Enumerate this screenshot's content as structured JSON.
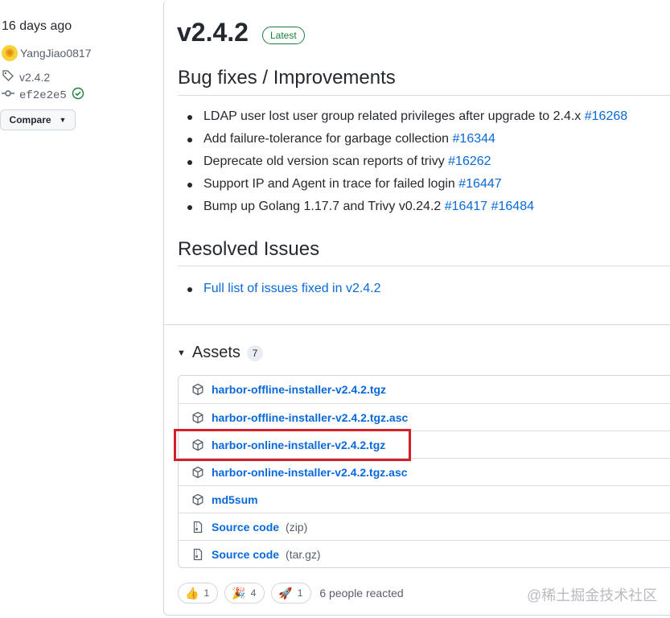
{
  "sidebar": {
    "time_ago": "16 days ago",
    "author": "YangJiao0817",
    "tag": "v2.4.2",
    "commit": "ef2e2e5",
    "compare_label": "Compare"
  },
  "release": {
    "version": "v2.4.2",
    "badge": "Latest",
    "bug_heading": "Bug fixes / Improvements",
    "bug_items": [
      {
        "text": "LDAP user lost user group related privileges after upgrade to 2.4.x ",
        "links": [
          "#16268"
        ]
      },
      {
        "text": "Add failure-tolerance for garbage collection ",
        "links": [
          "#16344"
        ]
      },
      {
        "text": "Deprecate old version scan reports of trivy ",
        "links": [
          "#16262"
        ]
      },
      {
        "text": "Support IP and Agent in trace for failed login ",
        "links": [
          "#16447"
        ]
      },
      {
        "text": "Bump up Golang 1.17.7 and Trivy v0.24.2 ",
        "links": [
          "#16417",
          "#16484"
        ]
      }
    ],
    "resolved_heading": "Resolved Issues",
    "resolved_link": "Full list of issues fixed in v2.4.2"
  },
  "assets": {
    "title": "Assets",
    "count": "7",
    "items": [
      {
        "name": "harbor-offline-installer-v2.4.2.tgz",
        "suffix": "",
        "icon": "package-icon"
      },
      {
        "name": "harbor-offline-installer-v2.4.2.tgz.asc",
        "suffix": "",
        "icon": "package-icon"
      },
      {
        "name": "harbor-online-installer-v2.4.2.tgz",
        "suffix": "",
        "icon": "package-icon"
      },
      {
        "name": "harbor-online-installer-v2.4.2.tgz.asc",
        "suffix": "",
        "icon": "package-icon"
      },
      {
        "name": "md5sum",
        "suffix": "",
        "icon": "package-icon"
      },
      {
        "name": "Source code",
        "suffix": "(zip)",
        "icon": "file-zip-icon"
      },
      {
        "name": "Source code",
        "suffix": "(tar.gz)",
        "icon": "file-zip-icon"
      }
    ]
  },
  "reactions": {
    "items": [
      {
        "emoji": "👍",
        "count": "1",
        "icon": "thumbs-up-icon"
      },
      {
        "emoji": "🎉",
        "count": "4",
        "icon": "hooray-icon"
      },
      {
        "emoji": "🚀",
        "count": "1",
        "icon": "rocket-icon"
      }
    ],
    "summary": "6 people reacted"
  },
  "watermark": "@稀土掘金技术社区",
  "colors": {
    "accent": "#0969da",
    "latest": "#1a7f37",
    "highlight": "#d32129"
  }
}
